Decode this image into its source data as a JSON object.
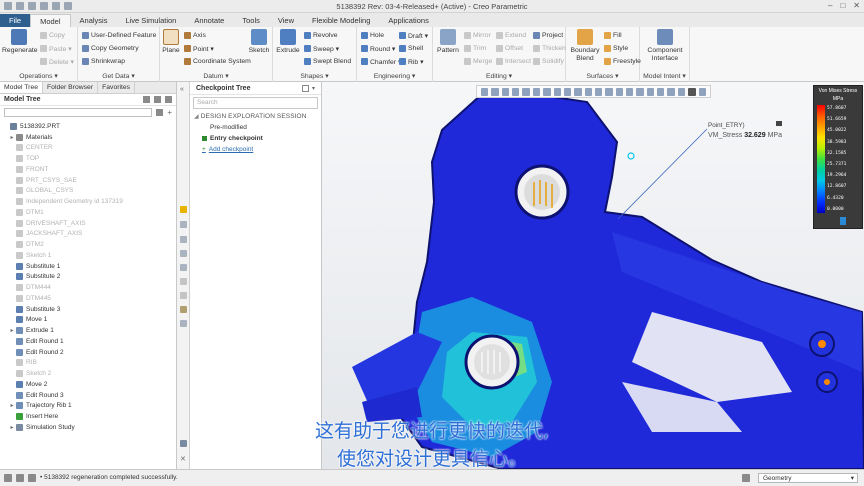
{
  "window": {
    "title": "5138392 Rev: 03-4-Released+ (Active) - Creo Parametric"
  },
  "tabs": [
    {
      "label": "File",
      "file": true
    },
    {
      "label": "Model",
      "active": true
    },
    {
      "label": "Analysis"
    },
    {
      "label": "Live Simulation"
    },
    {
      "label": "Annotate"
    },
    {
      "label": "Tools"
    },
    {
      "label": "View"
    },
    {
      "label": "Flexible Modeling"
    },
    {
      "label": "Applications"
    }
  ],
  "ribbon": {
    "operations": {
      "label": "Operations ▾",
      "regenerate": "Regenerate",
      "copy": "Copy",
      "paste": "Paste ▾",
      "delete": "Delete ▾"
    },
    "get_data": {
      "label": "Get Data ▾",
      "udf": "User-Defined Feature",
      "copy_geometry": "Copy Geometry",
      "shrinkwrap": "Shrinkwrap"
    },
    "datum": {
      "label": "Datum ▾",
      "plane": "Plane",
      "axis": "Axis",
      "point": "Point ▾",
      "csys": "Coordinate System",
      "sketch": "Sketch"
    },
    "shapes": {
      "label": "Shapes ▾",
      "extrude": "Extrude",
      "revolve": "Revolve",
      "sweep": "Sweep ▾",
      "swept_blend": "Swept Blend"
    },
    "engineering": {
      "label": "Engineering ▾",
      "hole": "Hole",
      "round": "Round ▾",
      "chamfer": "Chamfer ▾",
      "draft": "Draft ▾",
      "shell": "Shell",
      "rib": "Rib ▾"
    },
    "editing": {
      "label": "Editing ▾",
      "pattern": "Pattern",
      "mirror": "Mirror",
      "trim": "Trim",
      "merge": "Merge",
      "extend": "Extend",
      "offset": "Offset",
      "intersect": "Intersect",
      "project": "Project",
      "thicken": "Thicken",
      "solidify": "Solidify"
    },
    "surfaces": {
      "label": "Surfaces ▾",
      "boundary_blend": "Boundary Blend",
      "fill": "Fill",
      "style": "Style",
      "freestyle": "Freestyle"
    },
    "model_intent": {
      "label": "Model Intent ▾",
      "component_interface": "Component Interface"
    }
  },
  "left_panel": {
    "tabs": [
      "Model Tree",
      "Folder Browser",
      "Favorites"
    ],
    "header": "Model Tree",
    "tree": [
      {
        "label": "5138392.PRT",
        "indent": 0,
        "grey": false,
        "exp": "",
        "icon": "#6a7f99"
      },
      {
        "label": "Materials",
        "indent": 1,
        "grey": false,
        "exp": "▸",
        "icon": "#8a8a8a"
      },
      {
        "label": "CENTER",
        "indent": 1,
        "grey": true,
        "exp": "",
        "icon": "#c9c9c9"
      },
      {
        "label": "TOP",
        "indent": 1,
        "grey": true,
        "exp": "",
        "icon": "#c9c9c9"
      },
      {
        "label": "FRONT",
        "indent": 1,
        "grey": true,
        "exp": "",
        "icon": "#c9c9c9"
      },
      {
        "label": "PRT_CSYS_SAE",
        "indent": 1,
        "grey": true,
        "exp": "",
        "icon": "#c9c9c9"
      },
      {
        "label": "GLOBAL_CSYS",
        "indent": 1,
        "grey": true,
        "exp": "",
        "icon": "#c9c9c9"
      },
      {
        "label": "Independent Geometry id 137319",
        "indent": 1,
        "grey": true,
        "exp": "",
        "icon": "#c9c9c9"
      },
      {
        "label": "DTM1",
        "indent": 1,
        "grey": true,
        "exp": "",
        "icon": "#c9c9c9"
      },
      {
        "label": "DRIVESHAFT_AXIS",
        "indent": 1,
        "grey": true,
        "exp": "",
        "icon": "#c9c9c9"
      },
      {
        "label": "JACKSHAFT_AXIS",
        "indent": 1,
        "grey": true,
        "exp": "",
        "icon": "#c9c9c9"
      },
      {
        "label": "DTM2",
        "indent": 1,
        "grey": true,
        "exp": "",
        "icon": "#c9c9c9"
      },
      {
        "label": "Sketch 1",
        "indent": 1,
        "grey": true,
        "exp": "",
        "icon": "#c9c9c9"
      },
      {
        "label": "Substitute 1",
        "indent": 1,
        "grey": false,
        "exp": "",
        "icon": "#5b7fb0"
      },
      {
        "label": "Substitute 2",
        "indent": 1,
        "grey": false,
        "exp": "",
        "icon": "#5b7fb0"
      },
      {
        "label": "DTM444",
        "indent": 1,
        "grey": true,
        "exp": "",
        "icon": "#c9c9c9"
      },
      {
        "label": "DTM445",
        "indent": 1,
        "grey": true,
        "exp": "",
        "icon": "#c9c9c9"
      },
      {
        "label": "Substitute 3",
        "indent": 1,
        "grey": false,
        "exp": "",
        "icon": "#5b7fb0"
      },
      {
        "label": "Move 1",
        "indent": 1,
        "grey": false,
        "exp": "",
        "icon": "#5b7fb0"
      },
      {
        "label": "Extrude 1",
        "indent": 1,
        "grey": false,
        "exp": "▸",
        "icon": "#6f8fb8"
      },
      {
        "label": "Edit Round 1",
        "indent": 1,
        "grey": false,
        "exp": "",
        "icon": "#6f8fb8"
      },
      {
        "label": "Edit Round 2",
        "indent": 1,
        "grey": false,
        "exp": "",
        "icon": "#6f8fb8"
      },
      {
        "label": "RIB",
        "indent": 1,
        "grey": true,
        "exp": "",
        "icon": "#c9c9c9"
      },
      {
        "label": "Sketch 2",
        "indent": 1,
        "grey": true,
        "exp": "",
        "icon": "#c9c9c9"
      },
      {
        "label": "Move 2",
        "indent": 1,
        "grey": false,
        "exp": "",
        "icon": "#5b7fb0"
      },
      {
        "label": "Edit Round 3",
        "indent": 1,
        "grey": false,
        "exp": "",
        "icon": "#6f8fb8"
      },
      {
        "label": "Trajectory Rib 1",
        "indent": 1,
        "grey": false,
        "exp": "▸",
        "icon": "#6f8fb8"
      },
      {
        "label": "Insert Here",
        "indent": 1,
        "grey": false,
        "exp": "",
        "icon": "#3aa03a"
      },
      {
        "label": "Simulation Study",
        "indent": 1,
        "grey": false,
        "exp": "▸",
        "icon": "#7a8aa0"
      }
    ]
  },
  "checkpoint_panel": {
    "header": "Checkpoint Tree",
    "search_placeholder": "Search",
    "session": "DESIGN EXPLORATION SESSION",
    "pre_modified": "Pre-modified",
    "entry": "Entry checkpoint",
    "add": "Add checkpoint"
  },
  "viewport": {
    "probe": {
      "label": "Point_ETRY)",
      "quantity": "VM_Stress",
      "value": "32.629",
      "unit": "MPa"
    },
    "legend": {
      "title": "Von Mises Stress",
      "unit": "MPa",
      "values": [
        "57.8607",
        "51.6659",
        "45.0022",
        "38.5983",
        "32.1585",
        "25.7371",
        "19.2964",
        "12.8607",
        "6.4320",
        "0.0000"
      ]
    }
  },
  "captions": {
    "line1": "这有助于您进行更快的迭代,",
    "line2": "使您对设计更具信心。"
  },
  "status": {
    "message": "5138392 regeneration completed successfully.",
    "filter": "Geometry"
  }
}
